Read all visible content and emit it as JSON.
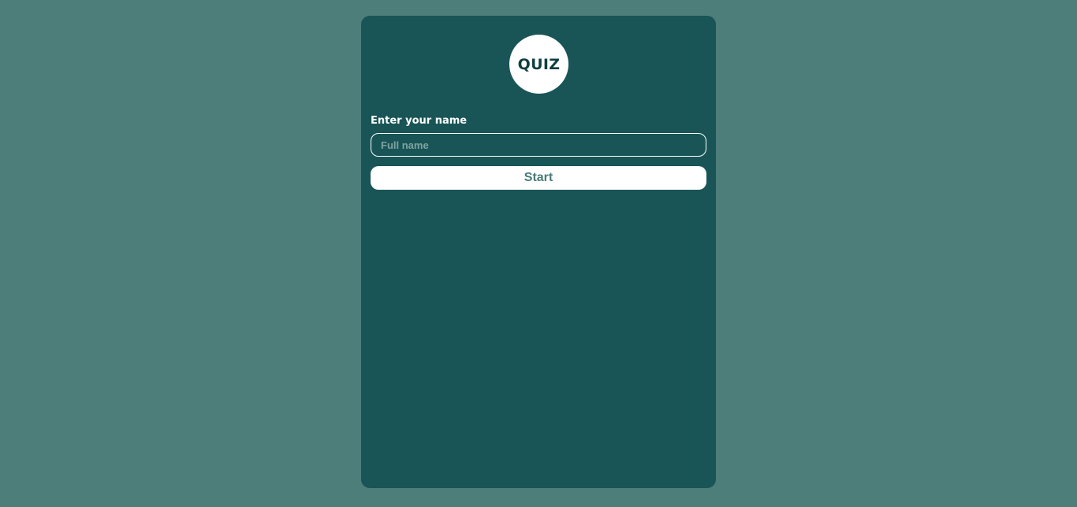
{
  "logo": {
    "text": "QUIZ"
  },
  "form": {
    "name_label": "Enter your name",
    "name_placeholder": "Full name",
    "name_value": "",
    "start_label": "Start"
  },
  "colors": {
    "page_background": "#4e7e7a",
    "card_background": "#195556",
    "logo_background": "#ffffff",
    "logo_text": "#0f3f40",
    "button_background": "#ffffff",
    "button_text": "#4a7a78"
  }
}
